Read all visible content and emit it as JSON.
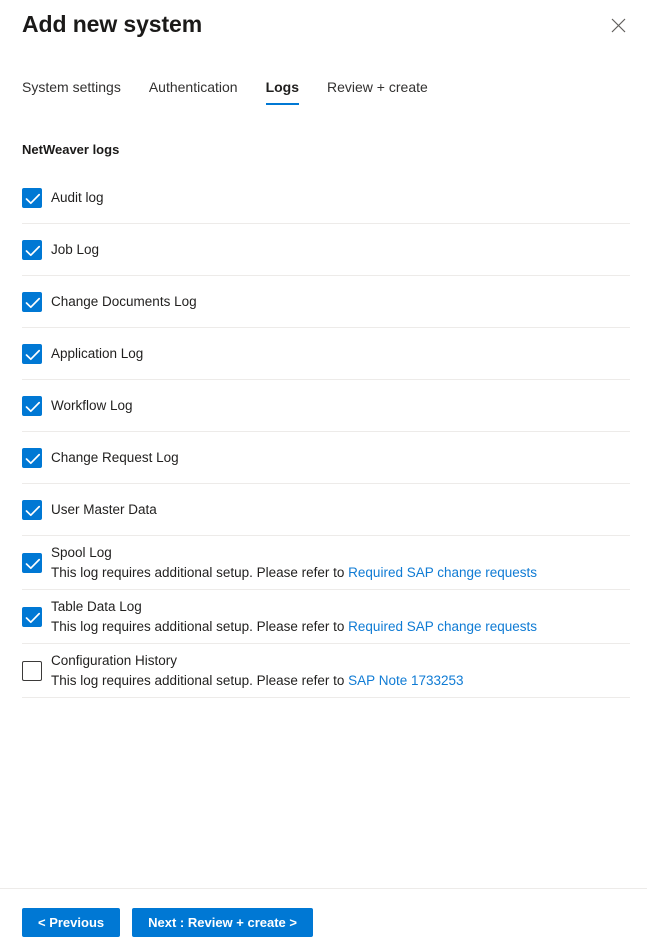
{
  "panel": {
    "title": "Add new system",
    "close_icon": "close-icon"
  },
  "tabs": [
    {
      "label": "System settings",
      "active": false
    },
    {
      "label": "Authentication",
      "active": false
    },
    {
      "label": "Logs",
      "active": true
    },
    {
      "label": "Review + create",
      "active": false
    }
  ],
  "section": {
    "heading": "NetWeaver logs"
  },
  "logs": [
    {
      "label": "Audit log",
      "checked": true,
      "desc": null,
      "link": null
    },
    {
      "label": "Job Log",
      "checked": true,
      "desc": null,
      "link": null
    },
    {
      "label": "Change Documents Log",
      "checked": true,
      "desc": null,
      "link": null
    },
    {
      "label": "Application Log",
      "checked": true,
      "desc": null,
      "link": null
    },
    {
      "label": "Workflow Log",
      "checked": true,
      "desc": null,
      "link": null
    },
    {
      "label": "Change Request Log",
      "checked": true,
      "desc": null,
      "link": null
    },
    {
      "label": "User Master Data",
      "checked": true,
      "desc": null,
      "link": null
    },
    {
      "label": "Spool Log",
      "checked": true,
      "desc": "This log requires additional setup. Please refer to ",
      "link": "Required SAP change requests"
    },
    {
      "label": "Table Data Log",
      "checked": true,
      "desc": "This log requires additional setup. Please refer to ",
      "link": "Required SAP change requests"
    },
    {
      "label": "Configuration History",
      "checked": false,
      "desc": "This log requires additional setup. Please refer to ",
      "link": "SAP Note 1733253"
    }
  ],
  "footer": {
    "previous_label": "< Previous",
    "next_label": "Next : Review + create >"
  },
  "colors": {
    "accent": "#0078d4",
    "link": "#0f7bd4",
    "divider": "#edebe9",
    "text": "#201f1e"
  }
}
